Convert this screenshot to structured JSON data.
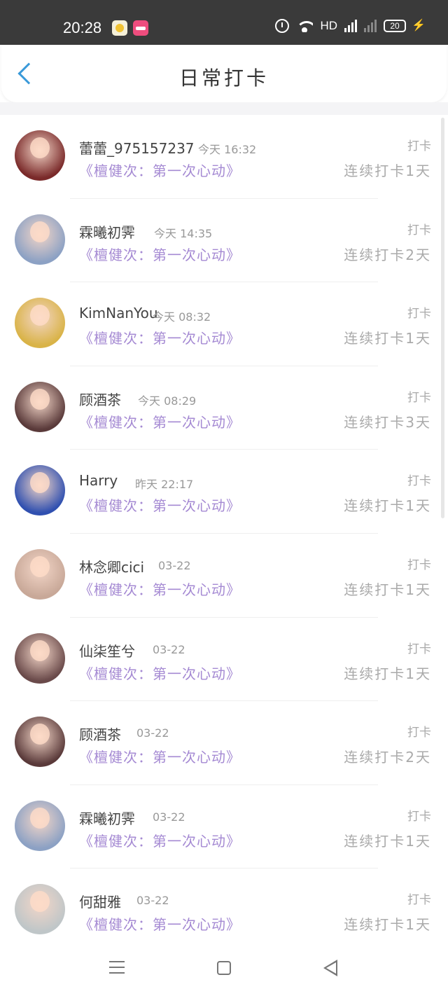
{
  "status_bar": {
    "time": "20:28",
    "network_label": "HD",
    "battery": "20",
    "app_icons": [
      "notes-app-icon",
      "video-app-icon"
    ]
  },
  "header": {
    "title": "日常打卡",
    "back_icon": "chevron-left-icon",
    "accent_color": "#3a9ad9"
  },
  "colors": {
    "course": "#a58ad3",
    "muted": "#aaaaaa"
  },
  "entries": [
    {
      "name": "蕾蕾_975157237",
      "time": "今天 16:32",
      "course": "《檀健次：第一次心动》",
      "action": "打卡",
      "streak": "连续打卡1天",
      "avatar_color": "#7a2a2a"
    },
    {
      "name": "霖曦初霁",
      "time": "今天 14:35",
      "course": "《檀健次：第一次心动》",
      "action": "打卡",
      "streak": "连续打卡2天",
      "avatar_color": "#8ca1c4"
    },
    {
      "name": "KimNanYou",
      "time": "今天 08:32",
      "course": "《檀健次：第一次心动》",
      "action": "打卡",
      "streak": "连续打卡1天",
      "avatar_color": "#d9b347"
    },
    {
      "name": "顾酒茶",
      "time": "今天 08:29",
      "course": "《檀健次：第一次心动》",
      "action": "打卡",
      "streak": "连续打卡3天",
      "avatar_color": "#5a3a3a"
    },
    {
      "name": "Harry",
      "time": "昨天 22:17",
      "course": "《檀健次：第一次心动》",
      "action": "打卡",
      "streak": "连续打卡1天",
      "avatar_color": "#3050b0"
    },
    {
      "name": "林念卿cici",
      "time": "03-22",
      "course": "《檀健次：第一次心动》",
      "action": "打卡",
      "streak": "连续打卡1天",
      "avatar_color": "#c8a898"
    },
    {
      "name": "仙柒笙兮",
      "time": "03-22",
      "course": "《檀健次：第一次心动》",
      "action": "打卡",
      "streak": "连续打卡1天",
      "avatar_color": "#6a4a4a"
    },
    {
      "name": "顾酒茶",
      "time": "03-22",
      "course": "《檀健次：第一次心动》",
      "action": "打卡",
      "streak": "连续打卡2天",
      "avatar_color": "#5a3a3a"
    },
    {
      "name": "霖曦初霁",
      "time": "03-22",
      "course": "《檀健次：第一次心动》",
      "action": "打卡",
      "streak": "连续打卡1天",
      "avatar_color": "#8ca1c4"
    },
    {
      "name": "何甜雅",
      "time": "03-22",
      "course": "《檀健次：第一次心动》",
      "action": "打卡",
      "streak": "连续打卡1天",
      "avatar_color": "#bfc6c8"
    }
  ],
  "nav_bar": {
    "menu_icon": "menu-icon",
    "home_icon": "home-icon",
    "back_icon": "back-triangle-icon"
  }
}
